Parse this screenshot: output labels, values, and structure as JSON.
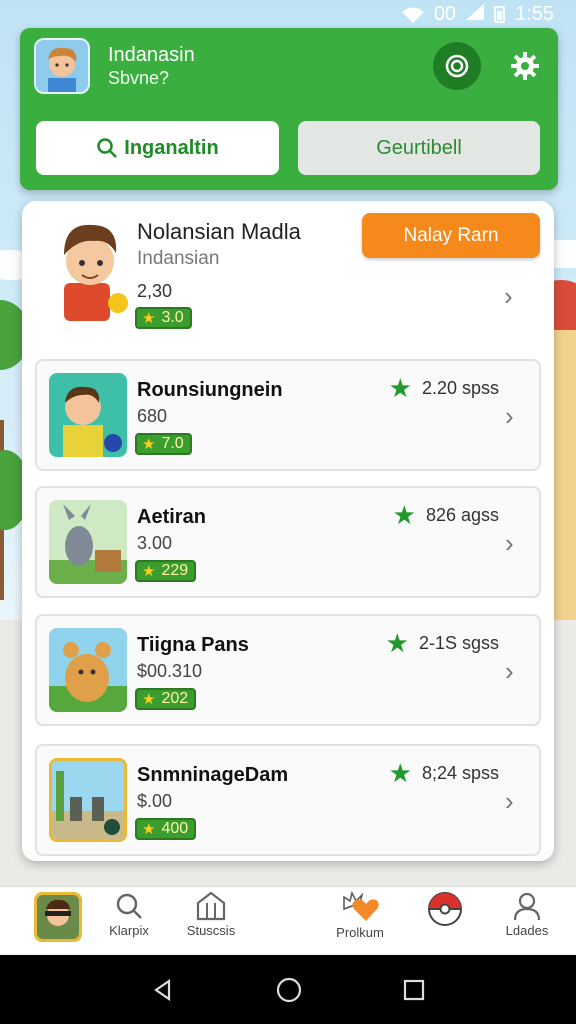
{
  "status_bar": {
    "signal_text": "00",
    "time": "1:55"
  },
  "header": {
    "title": "Indanasin",
    "subtitle": "Sbvne?",
    "tabs": [
      {
        "label": "Inganaltin",
        "icon": "search-icon",
        "active": true
      },
      {
        "label": "Geurtibell",
        "active": false
      }
    ],
    "colors": {
      "header_bg": "#3aae3e",
      "accent_dark": "#1f7d25"
    }
  },
  "featured": {
    "name": "Nolansian Madla",
    "subtitle": "Indansian",
    "value": "2,30",
    "score": "3.0",
    "action_label": "Nalay Rarn",
    "action_color": "#f5891b"
  },
  "items": [
    {
      "name": "Rounsiungnein",
      "price": "680",
      "rating": "2.20 spss",
      "score": "7.0"
    },
    {
      "name": "Aetiran",
      "price": "3.00",
      "rating": "826 agss",
      "score": "229"
    },
    {
      "name": "Tiigna Pans",
      "price": "$00.310",
      "rating": "2-1S sgss",
      "score": "202"
    },
    {
      "name": "SnmninageDam",
      "price": "$.00",
      "rating": "8;24 spss",
      "score": "400"
    }
  ],
  "bottom_nav": [
    {
      "label": "",
      "icon": "profile-avatar"
    },
    {
      "label": "Klarpix",
      "icon": "search-icon"
    },
    {
      "label": "Stuscsis",
      "icon": "store-icon"
    },
    {
      "label": "Prolkum",
      "icon": "heart-burst-icon"
    },
    {
      "label": "",
      "icon": "pokeball-icon"
    },
    {
      "label": "Ldades",
      "icon": "user-icon"
    }
  ]
}
